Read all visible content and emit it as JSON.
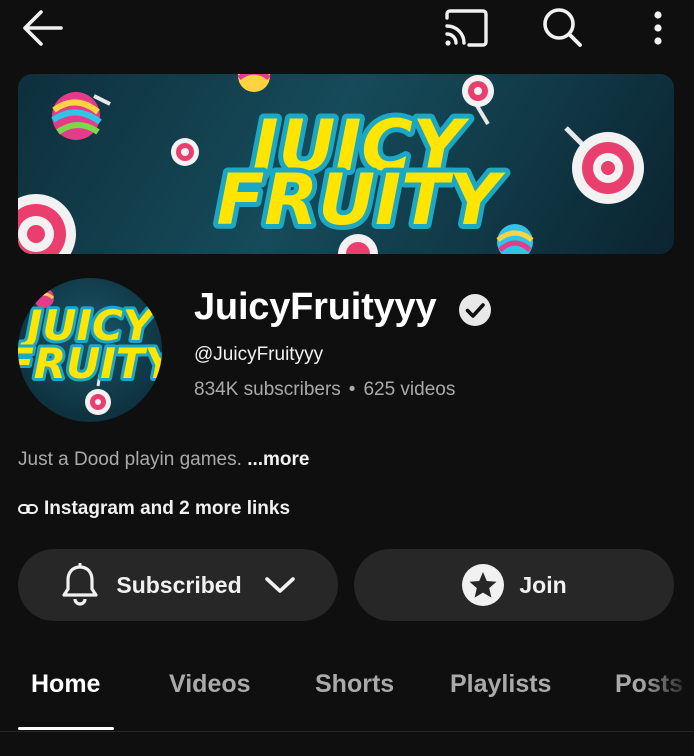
{
  "topbar": {
    "back_icon": "arrow-left-icon",
    "cast_icon": "cast-icon",
    "search_icon": "search-icon",
    "more_icon": "more-vert-icon"
  },
  "banner": {
    "title_line1": "JUICY",
    "title_line2": "FRUITY"
  },
  "channel": {
    "avatar_line1": "JUICY",
    "avatar_line2": "FRUITY",
    "name": "JuicyFruityyy",
    "handle": "@JuicyFruityyy",
    "subscribers": "834K subscribers",
    "separator": "•",
    "videos": "625 videos",
    "description": "Just a Dood playin games.",
    "more_label": "...more",
    "links_label": "Instagram and 2 more links"
  },
  "actions": {
    "subscribe_label": "Subscribed",
    "join_label": "Join"
  },
  "tabs": [
    {
      "label": "Home",
      "active": true
    },
    {
      "label": "Videos"
    },
    {
      "label": "Shorts"
    },
    {
      "label": "Playlists"
    },
    {
      "label": "Posts"
    }
  ],
  "colors": {
    "background": "#0f0f0f",
    "pill": "#272727",
    "muted_text": "#aaaaaa",
    "logo_yellow": "#ffe500",
    "logo_outline": "#1aa8c4"
  }
}
